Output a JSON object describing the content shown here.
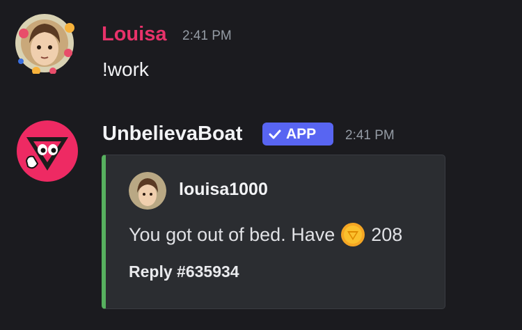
{
  "messages": [
    {
      "author": "Louisa",
      "time": "2:41 PM",
      "text": "!work",
      "name_color": "#e8326a"
    },
    {
      "author": "UnbelievaBoat",
      "badge": "APP",
      "time": "2:41 PM",
      "name_color": "#f2f3f5",
      "embed": {
        "accent": "#57b05f",
        "author_name": "louisa1000",
        "description_before": "You got out of bed. Have",
        "coin_icon": "coin-icon",
        "amount": "208",
        "footer": "Reply #635934"
      }
    }
  ]
}
